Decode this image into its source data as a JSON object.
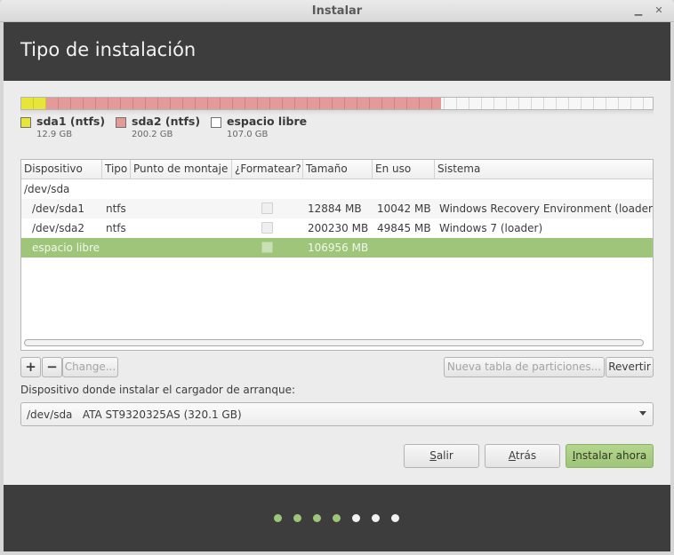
{
  "window": {
    "title": "Instalar",
    "minimize_icon": "minimize-icon",
    "close_icon": "close-icon"
  },
  "header": {
    "title": "Tipo de instalación"
  },
  "partition_bar": {
    "segments": [
      {
        "name": "sda1",
        "fraction": 0.04,
        "color": "#e8e53a"
      },
      {
        "name": "sda2",
        "fraction": 0.626,
        "color": "#e59a9a"
      },
      {
        "name": "espacio libre",
        "fraction": 0.334,
        "color": "#f7f7f7"
      }
    ]
  },
  "legend": [
    {
      "label": "sda1 (ntfs)",
      "size": "12.9 GB",
      "color": "#e8e53a"
    },
    {
      "label": "sda2 (ntfs)",
      "size": "200.2 GB",
      "color": "#e59a9a"
    },
    {
      "label": "espacio libre",
      "size": "107.0 GB",
      "color": "#ffffff"
    }
  ],
  "table": {
    "columns": [
      "Dispositivo",
      "Tipo",
      "Punto de montaje",
      "¿Formatear?",
      "Tamaño",
      "En uso",
      "Sistema"
    ],
    "rows": [
      {
        "device": "/dev/sda",
        "type": "",
        "mount": "",
        "format": null,
        "size": "",
        "used": "",
        "system": ""
      },
      {
        "device": "/dev/sda1",
        "type": "ntfs",
        "mount": "",
        "format": false,
        "size": "12884 MB",
        "used": "10042 MB",
        "system": "Windows Recovery Environment (loader)"
      },
      {
        "device": "/dev/sda2",
        "type": "ntfs",
        "mount": "",
        "format": false,
        "size": "200230 MB",
        "used": "49845 MB",
        "system": "Windows 7 (loader)"
      },
      {
        "device": "espacio libre",
        "type": "",
        "mount": "",
        "format": false,
        "size": "106956 MB",
        "used": "",
        "system": ""
      }
    ],
    "selected_row": 3
  },
  "toolbar": {
    "add_label": "+",
    "remove_label": "−",
    "change_label": "Change...",
    "new_table_label": "Nueva tabla de particiones...",
    "revert_label": "Revertir"
  },
  "bootloader": {
    "label": "Dispositivo donde instalar el cargador de arranque:",
    "value": "/dev/sda   ATA ST9320325AS (320.1 GB)"
  },
  "actions": {
    "quit_mnemonic": "S",
    "quit_rest": "alir",
    "back_mnemonic": "A",
    "back_rest": "trás",
    "install_mnemonic": "I",
    "install_rest": "nstalar ahora"
  },
  "progress": {
    "total_steps": 7,
    "completed_steps": 4,
    "active_color": "#9ec578",
    "inactive_color": "#f2f2f2"
  }
}
